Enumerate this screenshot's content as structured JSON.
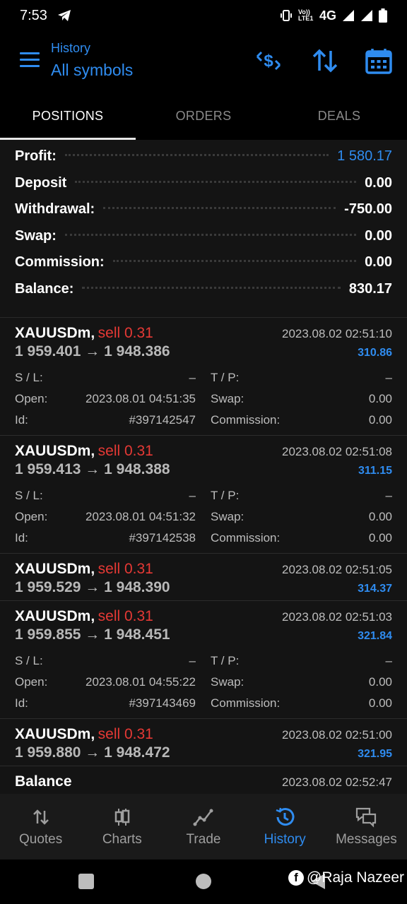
{
  "status_bar": {
    "time": "7:53",
    "network": "4G",
    "carrier_badge": "Vo)) LTE1"
  },
  "header": {
    "subtitle": "History",
    "title": "All symbols"
  },
  "tabs": [
    {
      "label": "POSITIONS",
      "active": true
    },
    {
      "label": "ORDERS",
      "active": false
    },
    {
      "label": "DEALS",
      "active": false
    }
  ],
  "summary": {
    "profit_label": "Profit:",
    "profit_value": "1 580.17",
    "deposit_label": "Deposit",
    "deposit_value": "0.00",
    "withdrawal_label": "Withdrawal:",
    "withdrawal_value": "-750.00",
    "swap_label": "Swap:",
    "swap_value": "0.00",
    "commission_label": "Commission:",
    "commission_value": "0.00",
    "balance_label": "Balance:",
    "balance_value": "830.17"
  },
  "deals": [
    {
      "symbol": "XAUUSDm,",
      "side": "sell 0.31",
      "time": "2023.08.02 02:51:10",
      "open_price": "1 959.401",
      "close_price": "1 948.386",
      "profit": "310.86",
      "sl_label": "S / L:",
      "sl": "–",
      "tp_label": "T / P:",
      "tp": "–",
      "open_label": "Open:",
      "open_time": "2023.08.01 04:51:35",
      "swap_label": "Swap:",
      "swap": "0.00",
      "id_label": "Id:",
      "id": "#397142547",
      "commission_label": "Commission:",
      "commission": "0.00"
    },
    {
      "symbol": "XAUUSDm,",
      "side": "sell 0.31",
      "time": "2023.08.02 02:51:08",
      "open_price": "1 959.413",
      "close_price": "1 948.388",
      "profit": "311.15",
      "sl_label": "S / L:",
      "sl": "–",
      "tp_label": "T / P:",
      "tp": "–",
      "open_label": "Open:",
      "open_time": "2023.08.01 04:51:32",
      "swap_label": "Swap:",
      "swap": "0.00",
      "id_label": "Id:",
      "id": "#397142538",
      "commission_label": "Commission:",
      "commission": "0.00"
    },
    {
      "symbol": "XAUUSDm,",
      "side": "sell 0.31",
      "time": "2023.08.02 02:51:05",
      "open_price": "1 959.529",
      "close_price": "1 948.390",
      "profit": "314.37"
    },
    {
      "symbol": "XAUUSDm,",
      "side": "sell 0.31",
      "time": "2023.08.02 02:51:03",
      "open_price": "1 959.855",
      "close_price": "1 948.451",
      "profit": "321.84",
      "sl_label": "S / L:",
      "sl": "–",
      "tp_label": "T / P:",
      "tp": "–",
      "open_label": "Open:",
      "open_time": "2023.08.01 04:55:22",
      "swap_label": "Swap:",
      "swap": "0.00",
      "id_label": "Id:",
      "id": "#397143469",
      "commission_label": "Commission:",
      "commission": "0.00"
    },
    {
      "symbol": "XAUUSDm,",
      "side": "sell 0.31",
      "time": "2023.08.02 02:51:00",
      "open_price": "1 959.880",
      "close_price": "1 948.472",
      "profit": "321.95"
    }
  ],
  "balance_entry": {
    "label": "Balance",
    "time": "2023.08.02 02:52:47"
  },
  "bottom_nav": [
    {
      "label": "Quotes",
      "icon": "quotes-arrows-icon"
    },
    {
      "label": "Charts",
      "icon": "candlestick-icon"
    },
    {
      "label": "Trade",
      "icon": "trend-line-icon"
    },
    {
      "label": "History",
      "icon": "history-clock-icon",
      "active": true
    },
    {
      "label": "Messages",
      "icon": "chat-bubbles-icon"
    }
  ],
  "watermark": {
    "logo": "f",
    "text": "@Raja Nazeer"
  },
  "arrow_glyph": "→",
  "colors": {
    "accent_blue": "#2f8cf0",
    "sell_red": "#e53935",
    "background": "#141414"
  }
}
